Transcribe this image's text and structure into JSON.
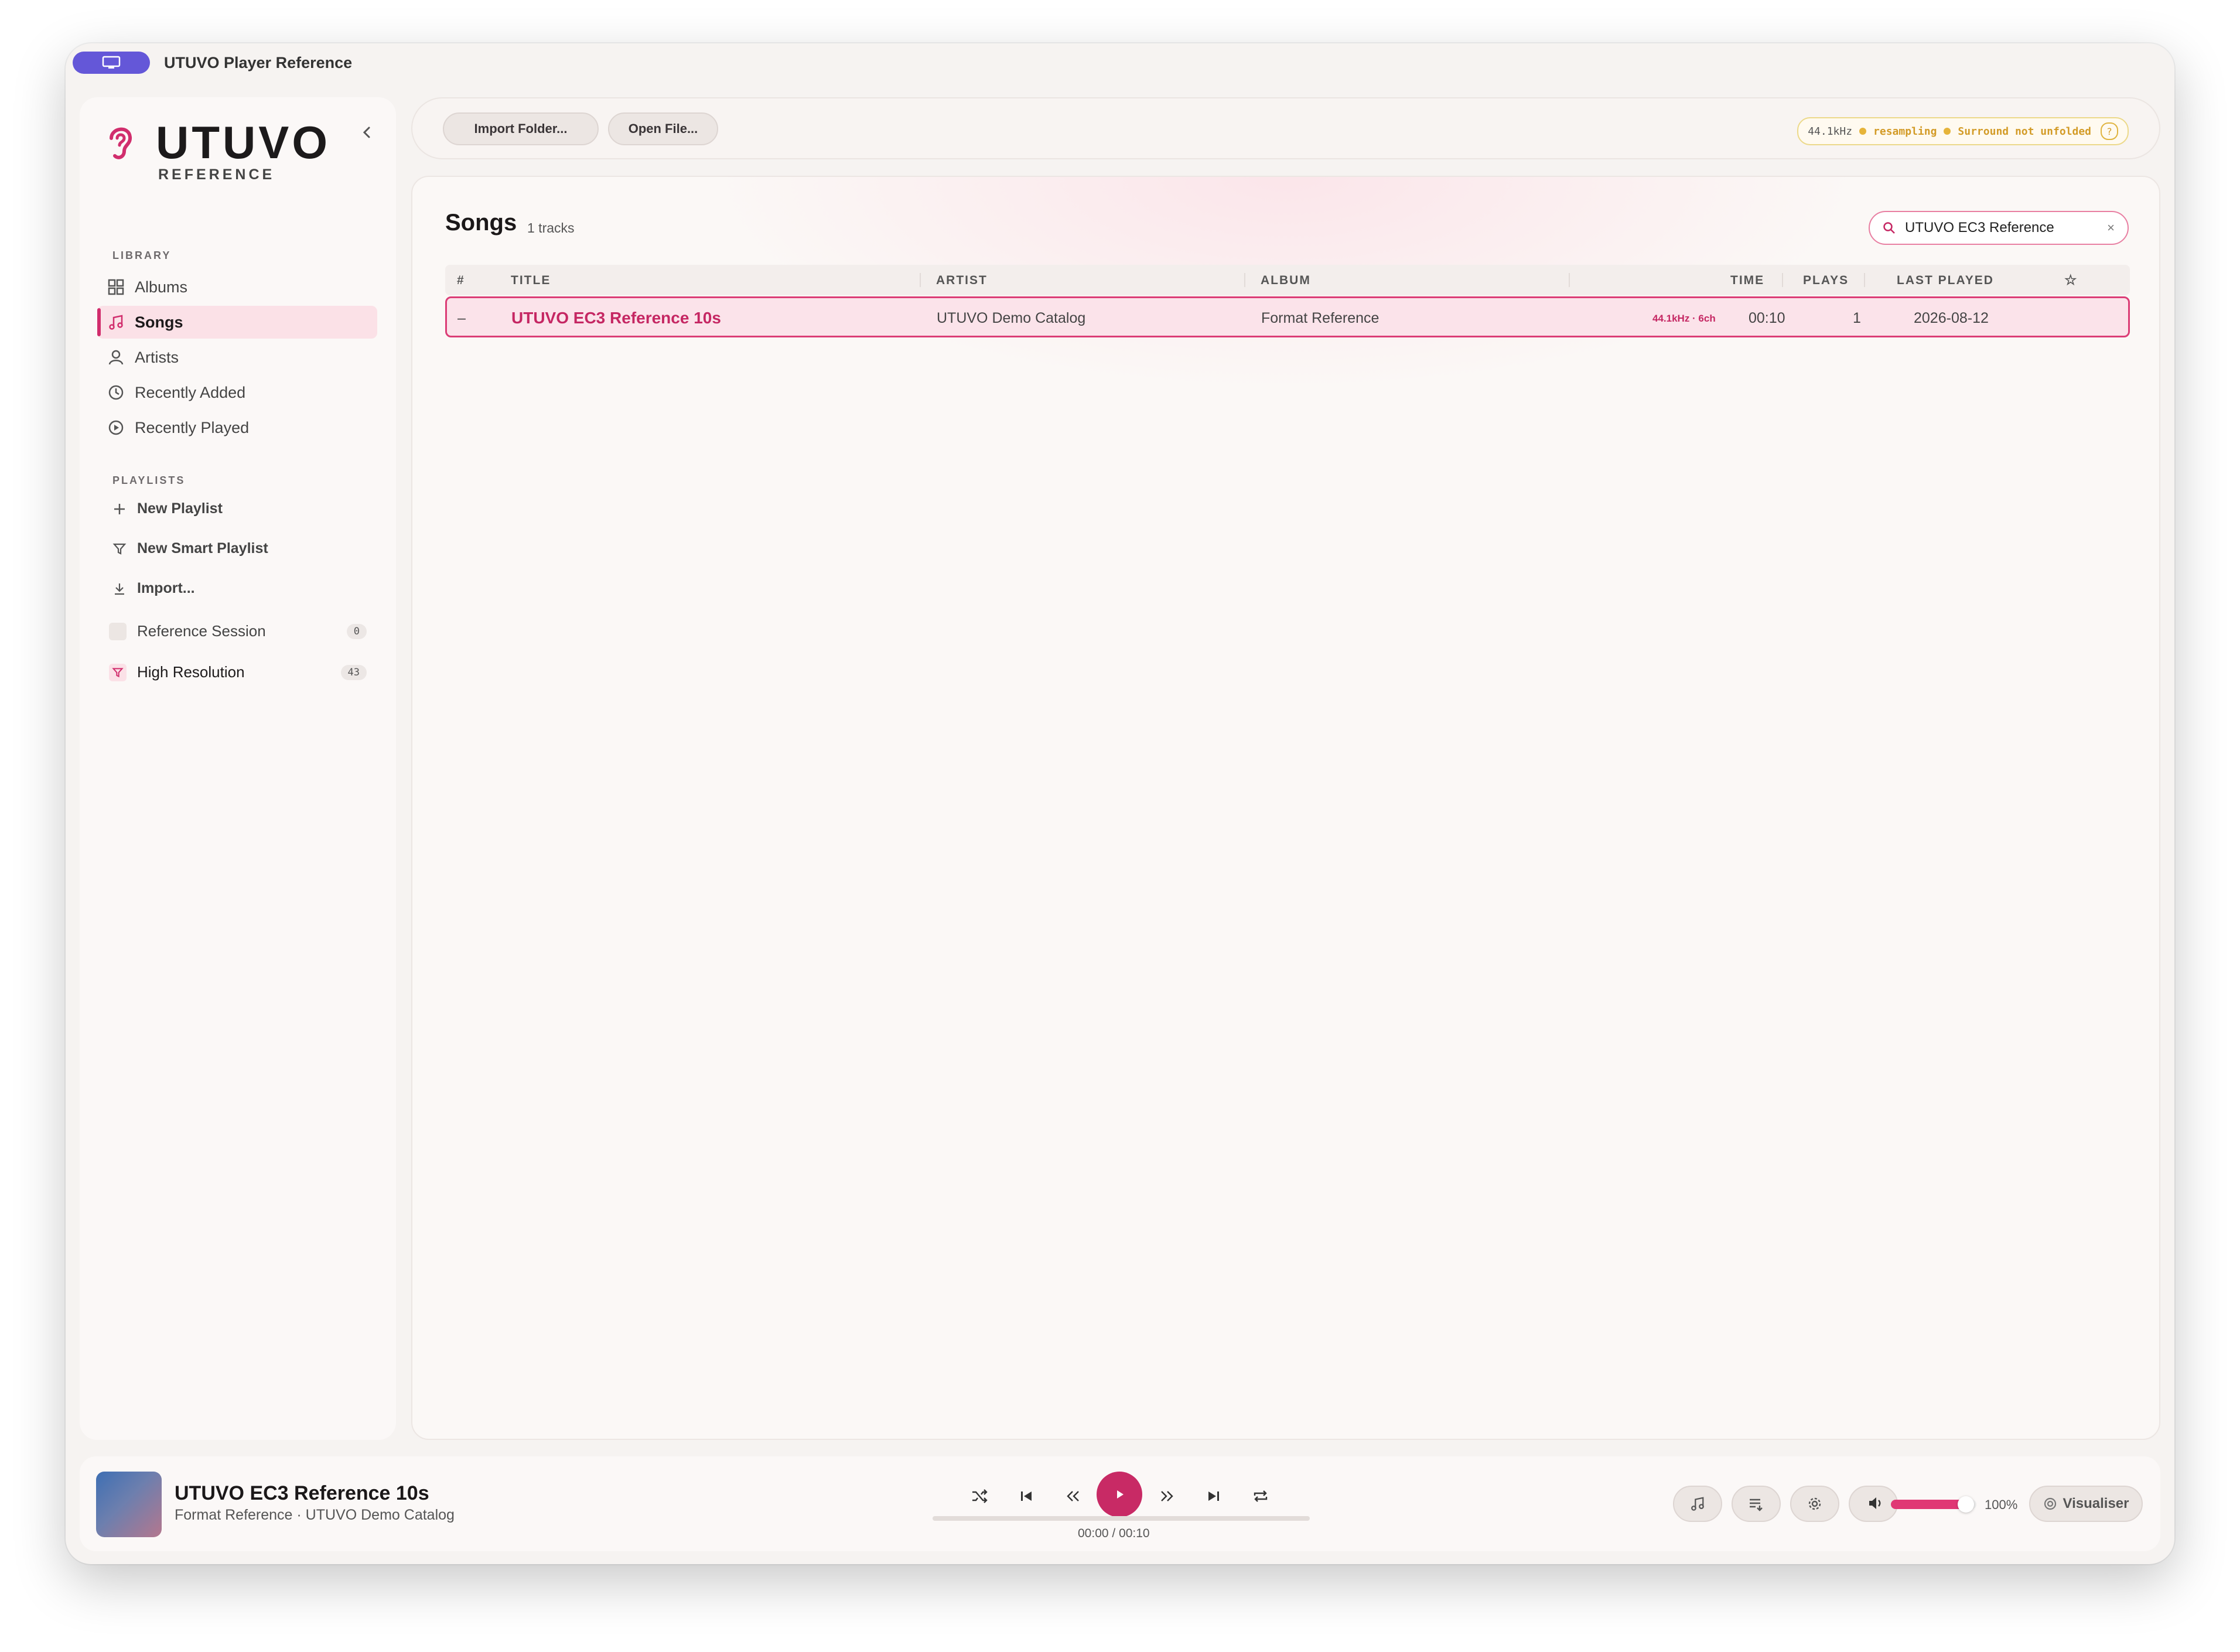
{
  "window": {
    "title": "UTUVO Player Reference"
  },
  "sidebar": {
    "brand": "UTUVO",
    "brand_sub": "REFERENCE",
    "library_label": "LIBRARY",
    "library": [
      {
        "label": "Albums",
        "icon": "grid-icon"
      },
      {
        "label": "Songs",
        "icon": "music-note-icon",
        "active": true
      },
      {
        "label": "Artists",
        "icon": "person-icon"
      },
      {
        "label": "Recently Added",
        "icon": "clock-icon"
      },
      {
        "label": "Recently Played",
        "icon": "play-circle-icon"
      }
    ],
    "playlists_label": "PLAYLISTS",
    "actions": [
      {
        "label": "New Playlist",
        "icon": "plus-icon"
      },
      {
        "label": "New Smart Playlist",
        "icon": "filter-icon"
      },
      {
        "label": "Import...",
        "icon": "download-icon"
      }
    ],
    "playlists": [
      {
        "label": "Reference Session",
        "count": "0"
      },
      {
        "label": "High Resolution",
        "count": "43",
        "smart": true
      }
    ]
  },
  "toolbar": {
    "import_folder": "Import Folder...",
    "open_file": "Open File...",
    "status": {
      "rate": "44.1kHz",
      "resampling": "resampling",
      "surround": "Surround not unfolded",
      "help": "?"
    }
  },
  "main": {
    "title": "Songs",
    "count": "1 tracks",
    "search": {
      "value": "UTUVO EC3 Reference",
      "clear": "×"
    },
    "columns": {
      "num": "#",
      "title": "TITLE",
      "artist": "ARTIST",
      "album": "ALBUM",
      "time": "TIME",
      "plays": "PLAYS",
      "last_played": "LAST PLAYED",
      "fav": "☆"
    },
    "rows": [
      {
        "num": "–",
        "title": "UTUVO EC3 Reference 10s",
        "artist": "UTUVO Demo Catalog",
        "album": "Format Reference",
        "format": "44.1kHz · 6ch",
        "time": "00:10",
        "plays": "1",
        "last_played": "2026-08-12"
      }
    ]
  },
  "player": {
    "title": "UTUVO EC3 Reference 10s",
    "subtitle": "Format Reference · UTUVO Demo Catalog",
    "time": "00:00 / 00:10",
    "progress": 0,
    "volume_percent": 88,
    "volume_label": "100%",
    "visualiser": "Visualiser",
    "accent": "#c82a65"
  }
}
